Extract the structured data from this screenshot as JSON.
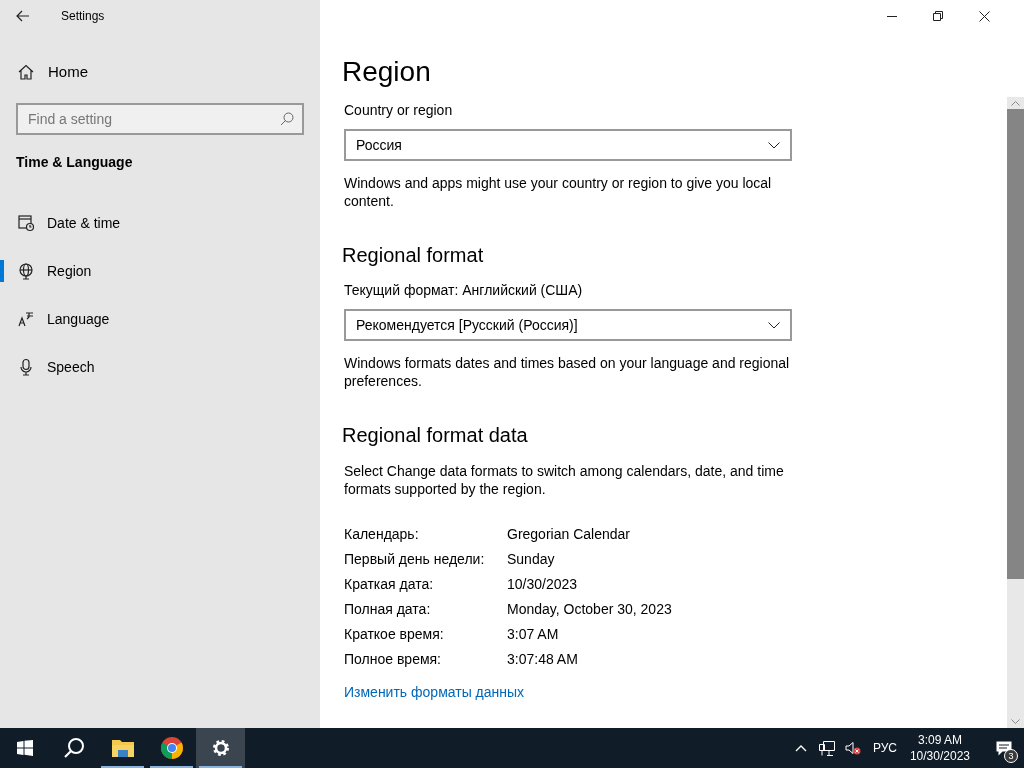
{
  "window": {
    "title": "Settings"
  },
  "sidebar": {
    "home": "Home",
    "search": {
      "placeholder": "Find a setting"
    },
    "section": "Time & Language",
    "items": [
      {
        "label": "Date & time",
        "kind": "calendar",
        "selected": false
      },
      {
        "label": "Region",
        "kind": "globe",
        "selected": true
      },
      {
        "label": "Language",
        "kind": "language",
        "selected": false
      },
      {
        "label": "Speech",
        "kind": "mic",
        "selected": false
      }
    ]
  },
  "page": {
    "title": "Region",
    "country": {
      "label": "Country or region",
      "value": "Россия",
      "note": "Windows and apps might use your country or region to give you local content."
    },
    "format": {
      "heading": "Regional format",
      "label": "Текущий формат: Английский (США)",
      "value": "Рекомендуется [Русский (Россия)]",
      "note": "Windows formats dates and times based on your language and regional preferences."
    },
    "format_data": {
      "heading": "Regional format data",
      "note": "Select Change data formats to switch among calendars, date, and time formats supported by the region.",
      "rows": [
        {
          "label": "Календарь:",
          "value": "Gregorian Calendar"
        },
        {
          "label": "Первый день недели:",
          "value": "Sunday"
        },
        {
          "label": "Краткая дата:",
          "value": "10/30/2023"
        },
        {
          "label": "Полная дата:",
          "value": "Monday, October 30, 2023"
        },
        {
          "label": "Краткое время:",
          "value": "3:07 AM"
        },
        {
          "label": "Полное время:",
          "value": "3:07:48 AM"
        }
      ],
      "link": "Изменить форматы данных"
    }
  },
  "taskbar": {
    "apps": [
      {
        "kind": "start",
        "selected": false
      },
      {
        "kind": "search",
        "selected": false
      },
      {
        "kind": "explorer",
        "selected": false
      },
      {
        "kind": "chrome",
        "selected": false
      },
      {
        "kind": "settings",
        "selected": true
      }
    ],
    "language": "РУС",
    "time": "3:09 AM",
    "date": "10/30/2023",
    "notifications": "3"
  }
}
